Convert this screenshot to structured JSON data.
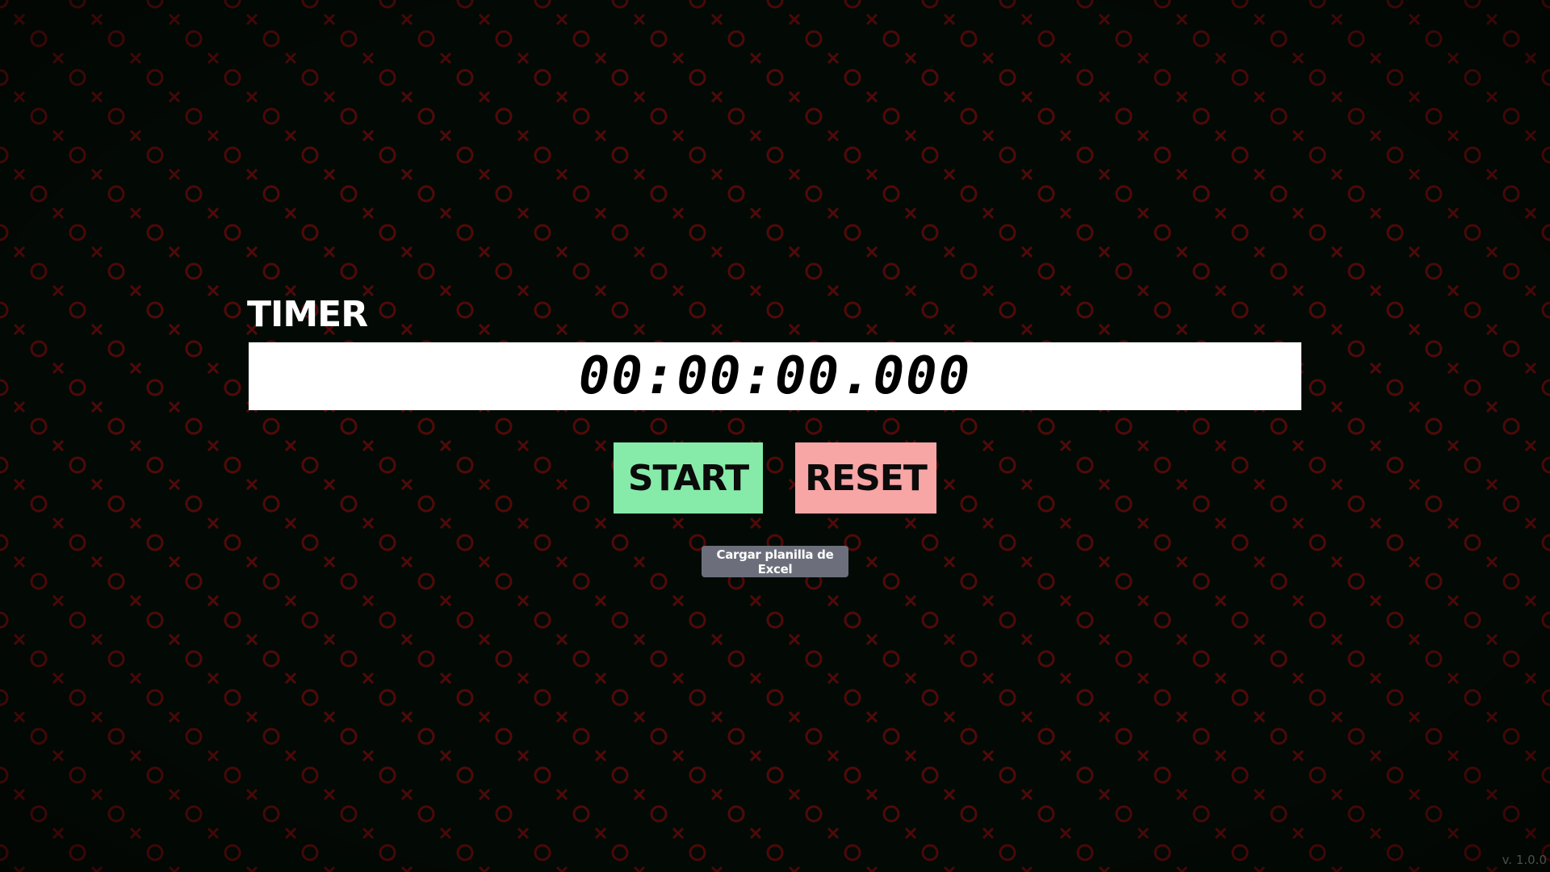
{
  "app": {
    "title": "TIMER",
    "version": "v. 1.0.0"
  },
  "timer": {
    "display": "00:00:00.000"
  },
  "controls": {
    "start_label": "START",
    "reset_label": "RESET",
    "excel_label": "Cargar planilla de Excel"
  },
  "colors": {
    "background": "#030a05",
    "pattern": "#5a0a0a",
    "start_button": "#86eba9",
    "reset_button": "#f8a5a5",
    "excel_button": "#6c6f7b",
    "display_background": "#ffffff"
  }
}
